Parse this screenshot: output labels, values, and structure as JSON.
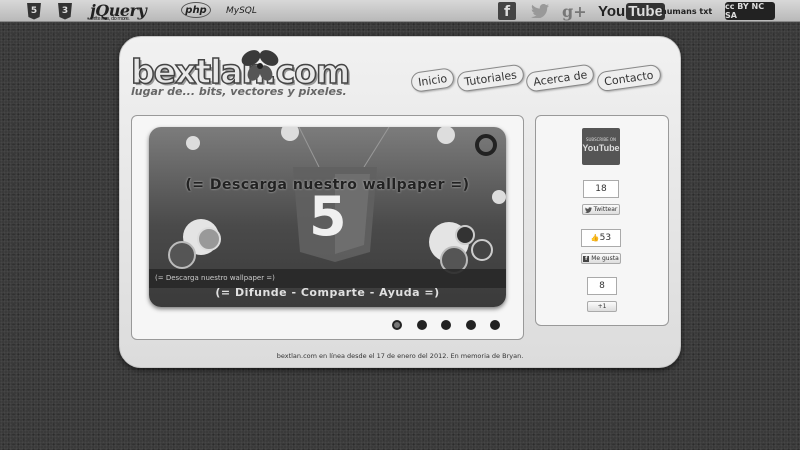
{
  "topbar": {
    "html5_badge": "5",
    "css3_badge": "3",
    "jquery": "jQuery",
    "jquery_sub": "write less, do more.",
    "php": "php",
    "mysql": "MySQL",
    "facebook": "f",
    "googleplus": "g+",
    "youtube_you": "You",
    "youtube_tube": "Tube",
    "humanstxt": "humans txt",
    "cc": "cc BY NC SA"
  },
  "logo": {
    "name": "bextlan.com",
    "tagline": "lugar de... bits, vectores y pixeles."
  },
  "nav": [
    {
      "label": "Inicio"
    },
    {
      "label": "Tutoriales"
    },
    {
      "label": "Acerca de"
    },
    {
      "label": "Contacto"
    }
  ],
  "slider": {
    "title": "(= Descarga nuestro wallpaper =)",
    "caption": "(= Descarga nuestro wallpaper =)",
    "footer": "(= Difunde - Comparte - Ayuda =)",
    "html5_number": "5",
    "slide_count": 5,
    "active_index": 0
  },
  "social": {
    "youtube_subscribe": "SUBSCRIBE ON",
    "youtube_label": "YouTube",
    "twitter_count": "18",
    "twitter_button": "Twittear",
    "facebook_count": "53",
    "facebook_button": "Me gusta",
    "gplus_count": "8",
    "gplus_button": "+1"
  },
  "footer": {
    "text": "bextlan.com en línea desde el 17 de enero del 2012. En memoria de Bryan."
  }
}
